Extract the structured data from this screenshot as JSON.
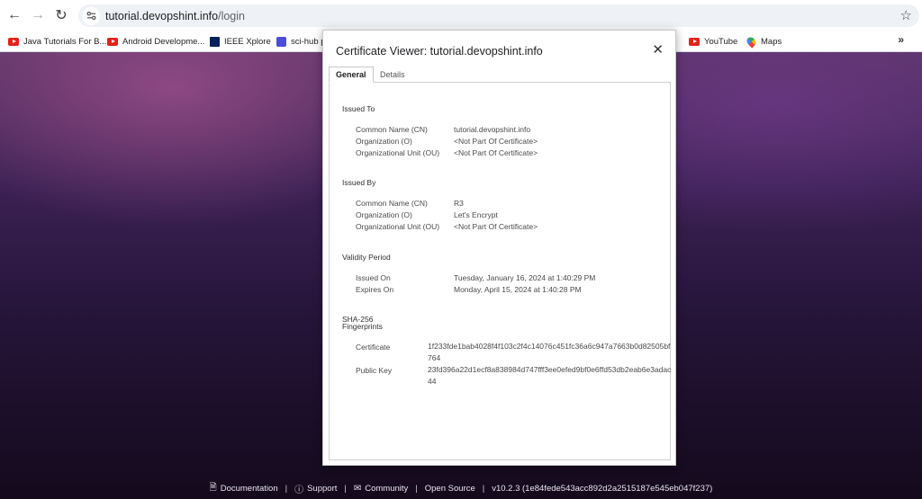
{
  "browser": {
    "url_host": "tutorial.devopshint.info",
    "url_path": "/login"
  },
  "bookmarks": [
    {
      "label": "Java Tutorials For B...",
      "icon": "youtube-icon"
    },
    {
      "label": "Android Developme...",
      "icon": "youtube-icon"
    },
    {
      "label": "IEEE Xplore",
      "icon": "ieee-icon"
    },
    {
      "label": "sci-hub p",
      "icon": "scihub-icon"
    },
    {
      "label": "YouTube",
      "icon": "youtube-icon"
    },
    {
      "label": "Maps",
      "icon": "maps-icon"
    }
  ],
  "dialog": {
    "title": "Certificate Viewer: tutorial.devopshint.info",
    "tabs": [
      "General",
      "Details"
    ],
    "issued_to": {
      "heading": "Issued To",
      "rows": [
        {
          "label": "Common Name (CN)",
          "value": "tutorial.devopshint.info"
        },
        {
          "label": "Organization (O)",
          "value": "<Not Part Of Certificate>"
        },
        {
          "label": "Organizational Unit (OU)",
          "value": "<Not Part Of Certificate>"
        }
      ]
    },
    "issued_by": {
      "heading": "Issued By",
      "rows": [
        {
          "label": "Common Name (CN)",
          "value": "R3"
        },
        {
          "label": "Organization (O)",
          "value": "Let's Encrypt"
        },
        {
          "label": "Organizational Unit (OU)",
          "value": "<Not Part Of Certificate>"
        }
      ]
    },
    "validity": {
      "heading": "Validity Period",
      "rows": [
        {
          "label": "Issued On",
          "value": "Tuesday, January 16, 2024 at 1:40:29 PM"
        },
        {
          "label": "Expires On",
          "value": "Monday, April 15, 2024 at 1:40:28 PM"
        }
      ]
    },
    "fingerprints": {
      "heading_line1": "SHA-256",
      "heading_line2": "Fingerprints",
      "rows": [
        {
          "label": "Certificate",
          "value": "1f233fde1bab4028f4f103c2f4c14076c451fc36a6c947a7663b0d82505bf764"
        },
        {
          "label": "Public Key",
          "value": "23fd396a22d1ecf8a838984d747fff3ee0efed9bf0e6ffd53db2eab6e3adac44"
        }
      ]
    }
  },
  "footer": {
    "documentation": "Documentation",
    "support": "Support",
    "community": "Community",
    "open_source": "Open Source",
    "version": "v10.2.3 (1e84fede543acc892d2a2515187e545eb047f237)"
  }
}
